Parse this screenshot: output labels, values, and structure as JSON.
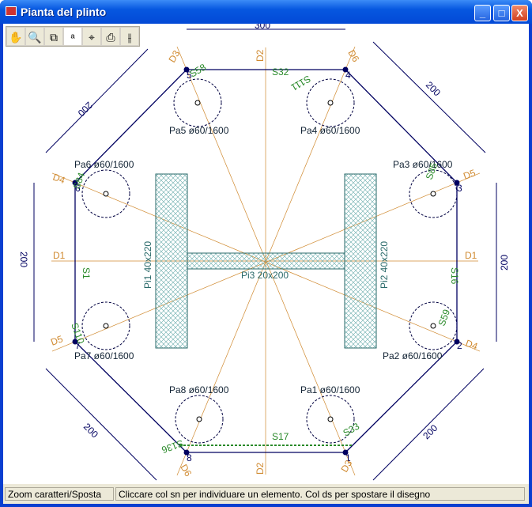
{
  "window": {
    "title": "Pianta del plinto",
    "buttons": {
      "minimize": "_",
      "maximize": "□",
      "close": "X"
    }
  },
  "toolbar": [
    {
      "name": "pan-hand",
      "glyph": "✋"
    },
    {
      "name": "zoom-window",
      "glyph": "🔍"
    },
    {
      "name": "zoom-extents",
      "glyph": "⧉"
    },
    {
      "name": "zoom-text",
      "glyph": "ᵃ"
    },
    {
      "name": "locate",
      "glyph": "⌖"
    },
    {
      "name": "print",
      "glyph": "⎙"
    },
    {
      "name": "settings",
      "glyph": "⫲"
    }
  ],
  "drawing": {
    "top_dimension": "300",
    "dimensions": [
      "200",
      "200",
      "200",
      "200",
      "200",
      "200"
    ],
    "vertices": [
      "1",
      "2",
      "3",
      "4",
      "5",
      "6",
      "7",
      "8"
    ],
    "piles": [
      "Pa1  ø60/1600",
      "Pa2  ø60/1600",
      "Pa3  ø60/1600",
      "Pa4  ø60/1600",
      "Pa5  ø60/1600",
      "Pa6  ø60/1600",
      "Pa7  ø60/1600",
      "Pa8  ø60/1600"
    ],
    "columns": [
      "Pi1 40x220",
      "Pi2 40x220",
      "Pi3 20x200"
    ],
    "directions": {
      "D1": "D1",
      "D2": "D2",
      "D3": "D3",
      "D4": "D4",
      "D5": "D5",
      "D6": "D6"
    },
    "sections": {
      "S1": "S1",
      "S16": "S16",
      "S32": "S32",
      "S17": "S17",
      "S58": "S58",
      "S111": "S111",
      "S85": "S85",
      "S59": "S59",
      "S110": "S110",
      "S33": "S33",
      "S136": "S136",
      "S84": "S84"
    },
    "colors": {
      "outline": "#000060",
      "axis": "#d08a30",
      "section": "#2a8a2a",
      "column": "#2a6a6a",
      "pile": "#000040"
    }
  },
  "status": {
    "mode": "Zoom caratteri/Sposta",
    "hint": "Cliccare col sn per individuare un elemento. Col ds per spostare il disegno"
  }
}
